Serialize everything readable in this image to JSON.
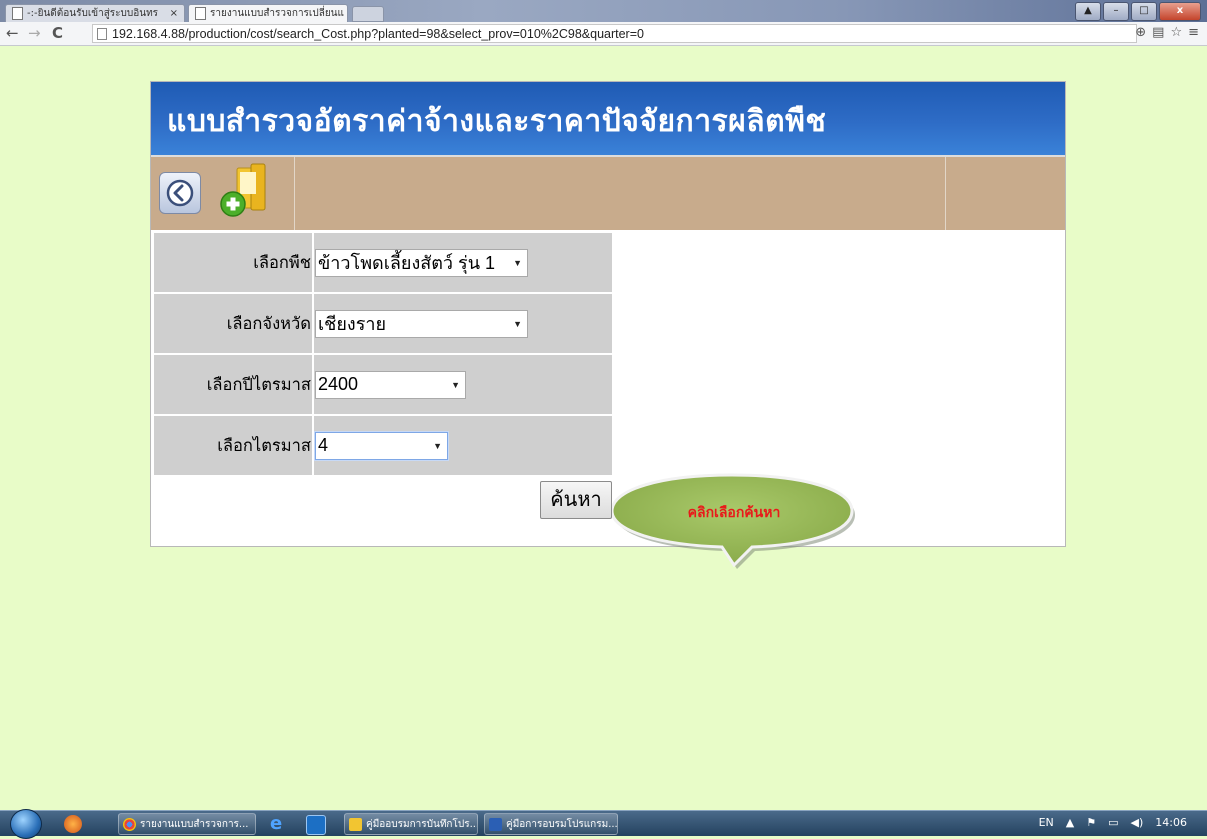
{
  "browser": {
    "tabs": [
      {
        "title": "-:-ยินดีต้อนรับเข้าสู่ระบบอินทร"
      },
      {
        "title": "รายงานแบบสำรวจการเปลี่ยนแ"
      }
    ],
    "url": "192.168.4.88/production/cost/search_Cost.php?planted=98&select_prov=010%2C98&quarter=0"
  },
  "page": {
    "title": "แบบสำรวจอัตราค่าจ้างและราคาปัจจัยการผลิตพืช",
    "form": {
      "crop": {
        "label": "เลือกพืช",
        "value": "ข้าวโพดเลี้ยงสัตว์ รุ่น 1"
      },
      "province": {
        "label": "เลือกจังหวัด",
        "value": "เชียงราย"
      },
      "year": {
        "label": "เลือกปีไตรมาส",
        "value": "2400"
      },
      "quarter": {
        "label": "เลือกไตรมาส",
        "value": "4"
      }
    },
    "search_button": "ค้นหา",
    "callout": "คลิกเลือกค้นหา"
  },
  "taskbar": {
    "tasks": [
      {
        "label": "รายงานแบบสำรวจการ..."
      },
      {
        "label": "คู่มืออบรมการบันทึกโปร..."
      },
      {
        "label": "คู่มือการอบรมโปรแกรม..."
      }
    ],
    "lang": "EN",
    "time": "14:06"
  },
  "colors": {
    "page_background": "#e8fcc8",
    "banner": "#2e6cc6",
    "toolbar": "#c8ab8c",
    "callout_fill": "#9bbb59",
    "callout_text": "#e81a1a"
  }
}
